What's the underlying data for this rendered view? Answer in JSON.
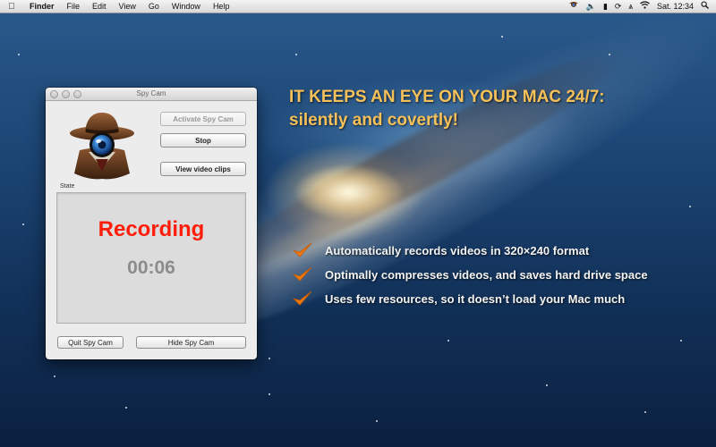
{
  "menubar": {
    "app_menu": "Finder",
    "items": [
      "File",
      "Edit",
      "View",
      "Go",
      "Window",
      "Help"
    ],
    "clock": "Sat. 12:34"
  },
  "window": {
    "title": "Spy Cam",
    "buttons": {
      "activate": "Activate Spy Cam",
      "stop": "Stop",
      "view_clips": "View video clips",
      "quit": "Quit Spy Cam",
      "hide": "Hide Spy Cam"
    },
    "state_label": "State",
    "status": "Recording",
    "timer": "00:06"
  },
  "promo": {
    "headline_line1": "IT KEEPS AN EYE ON YOUR MAC 24/7:",
    "headline_line2": "silently and covertly!",
    "features": [
      "Automatically records videos in 320×240 format",
      "Optimally compresses videos, and saves hard drive space",
      "Uses few resources, so it doesn’t load your Mac much"
    ]
  },
  "colors": {
    "headline": "#f7c15a",
    "recording": "#ff1d0a",
    "timer": "#8c8c8c",
    "checkmark": "#f07a10"
  }
}
